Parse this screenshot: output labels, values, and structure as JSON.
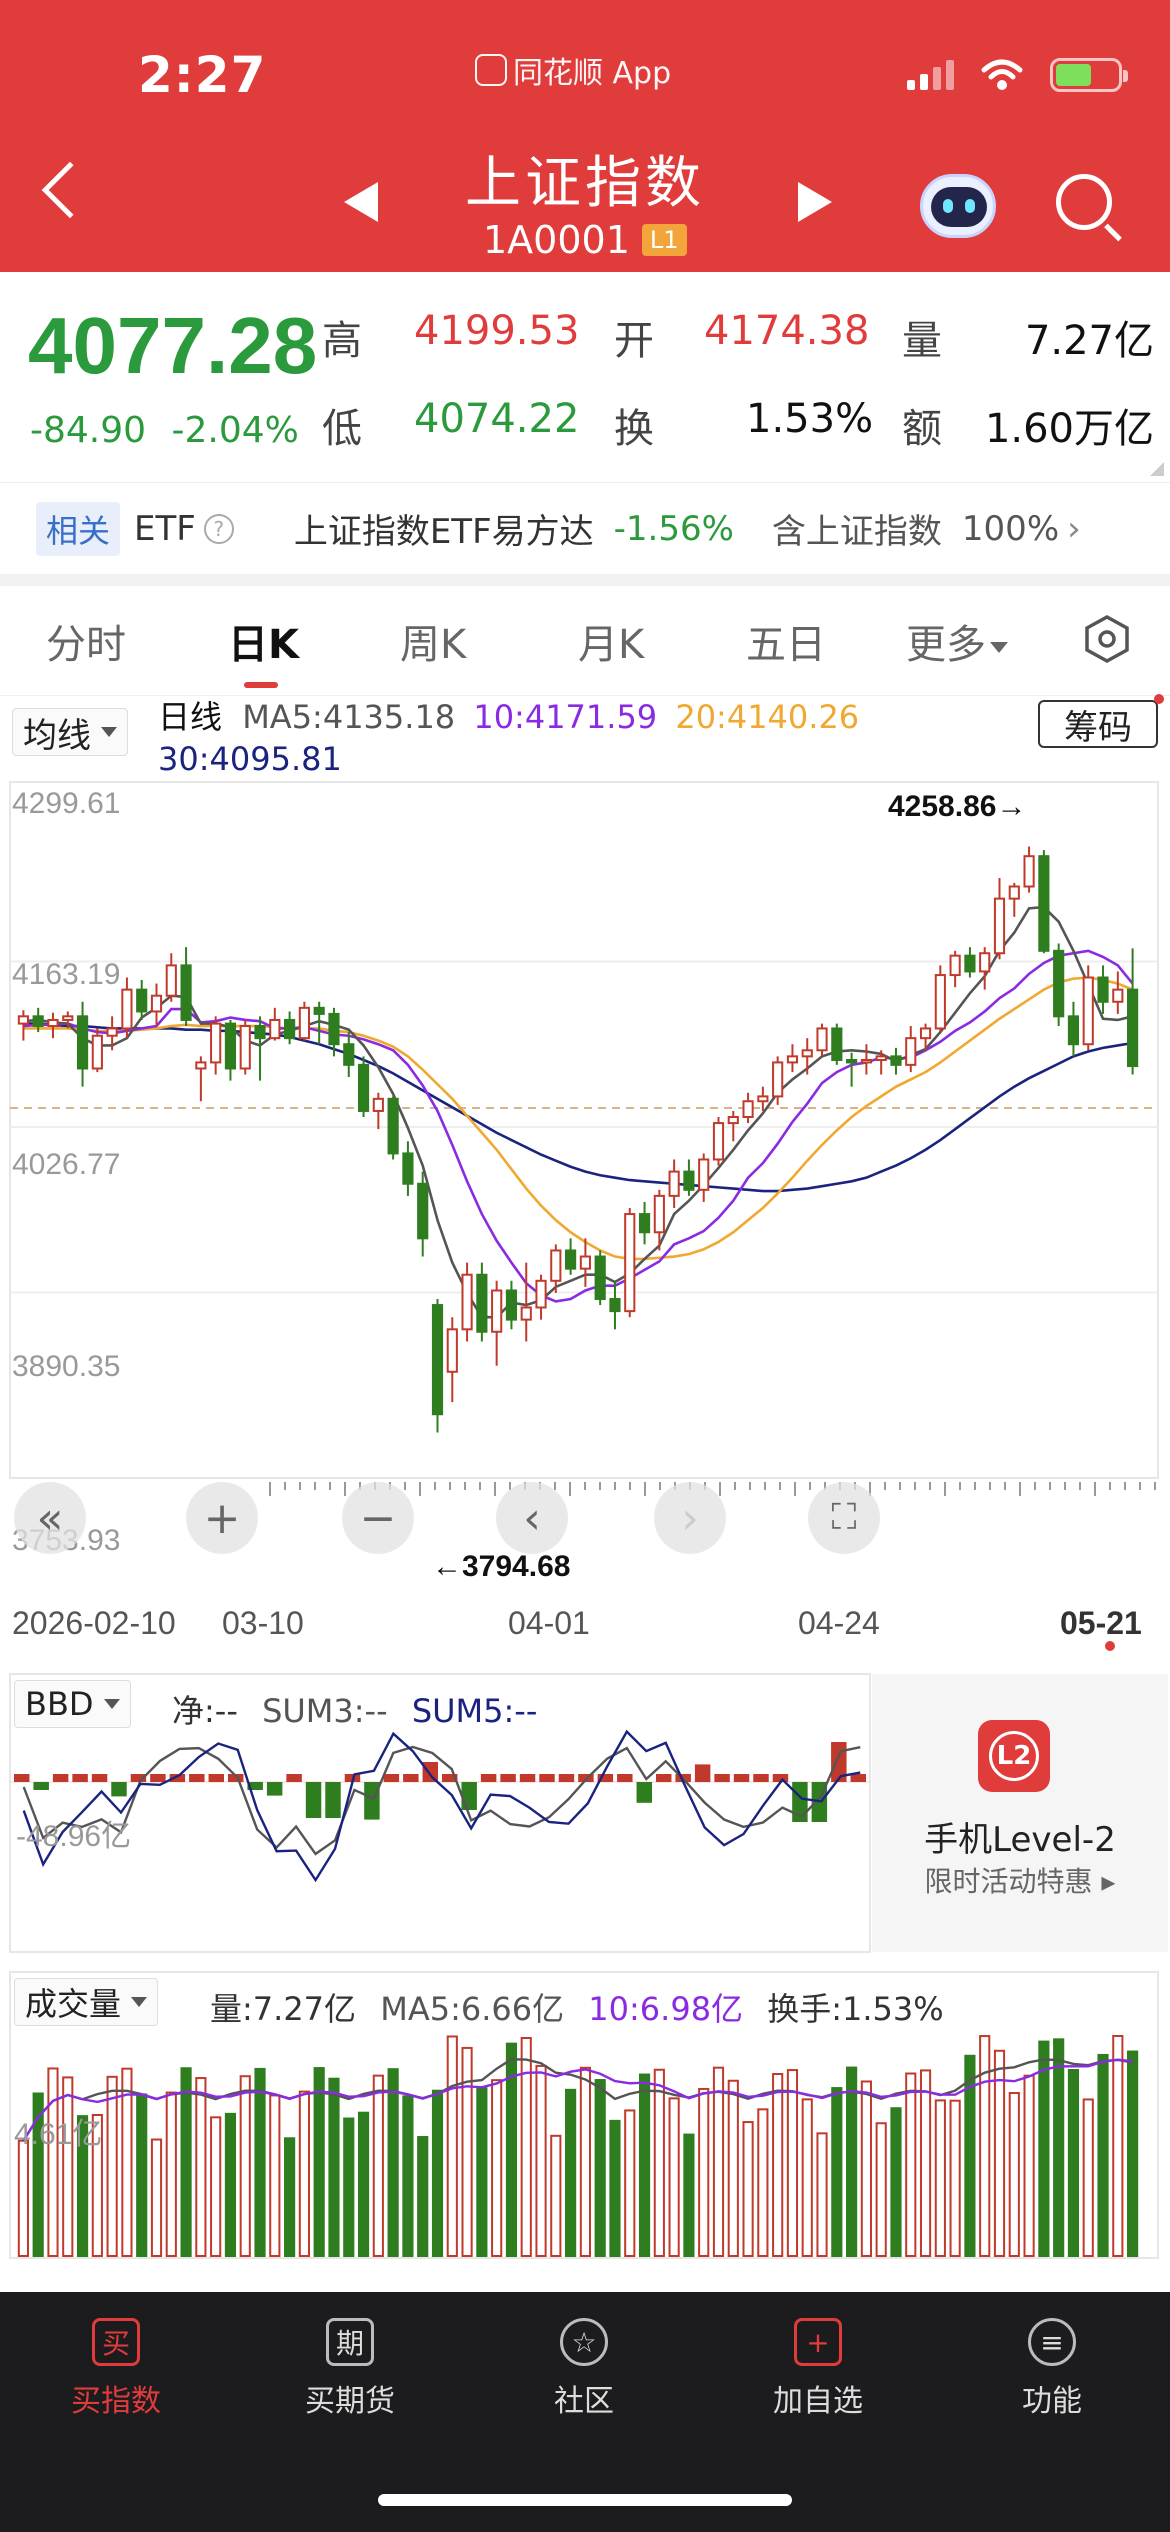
{
  "status": {
    "time": "2:27",
    "app_name": "同花顺 App"
  },
  "header": {
    "title": "上证指数",
    "code": "1A0001",
    "level_badge": "L1"
  },
  "quote": {
    "price": "4077.28",
    "change": "-84.90",
    "change_pct": "-2.04%",
    "high_label": "高",
    "high": "4199.53",
    "open_label": "开",
    "open": "4174.38",
    "volume_label": "量",
    "volume": "7.27亿",
    "low_label": "低",
    "low": "4074.22",
    "turnover_label": "换",
    "turnover": "1.53%",
    "amount_label": "额",
    "amount": "1.60万亿"
  },
  "related": {
    "tag": "相关",
    "etf": "ETF",
    "fund_name": "上证指数ETF易方达",
    "fund_change": "-1.56%",
    "contains": "含上证指数",
    "contains_pct": "100%"
  },
  "tabs": [
    {
      "label": "分时"
    },
    {
      "label": "日K"
    },
    {
      "label": "周K"
    },
    {
      "label": "月K"
    },
    {
      "label": "五日"
    },
    {
      "label": "更多"
    }
  ],
  "kline": {
    "ma_button": "均线",
    "period_label": "日线",
    "ma5": "MA5:4135.18",
    "ma10": "10:4171.59",
    "ma20": "20:4140.26",
    "ma30": "30:4095.81",
    "chip_button": "筹码",
    "y_ticks": [
      "4299.61",
      "4163.19",
      "4026.77",
      "3890.35",
      "3753.93"
    ],
    "high_marker": "4258.86→",
    "low_marker": "←3794.68",
    "x_ticks": [
      "2026-02-10",
      "03-10",
      "04-01",
      "04-24",
      "05-21"
    ]
  },
  "colors": {
    "up": "#c0392b",
    "down": "#2e7d1f",
    "ma5": "#555555",
    "ma10": "#8a2be2",
    "ma20": "#f0a830",
    "ma30": "#1a237e"
  },
  "bbd": {
    "button": "BBD",
    "net": "净:--",
    "sum3": "SUM3:--",
    "sum5": "SUM5:--",
    "axis_label": "-48.96亿"
  },
  "level2": {
    "title": "手机Level-2",
    "subtitle": "限时活动特惠 ▸",
    "logo": "L2"
  },
  "volume": {
    "button": "成交量",
    "vol": "量:7.27亿",
    "ma5": "MA5:6.66亿",
    "ma10": "10:6.98亿",
    "turnover": "换手:1.53%",
    "axis_label": "4.61亿"
  },
  "chart_data": {
    "type": "candlestick",
    "ylim": [
      3753.93,
      4299.61
    ],
    "candles": [
      [
        4112,
        4123,
        4098,
        4118
      ],
      [
        4118,
        4125,
        4105,
        4110
      ],
      [
        4110,
        4121,
        4100,
        4115
      ],
      [
        4115,
        4122,
        4108,
        4118
      ],
      [
        4118,
        4130,
        4060,
        4075
      ],
      [
        4075,
        4108,
        4072,
        4102
      ],
      [
        4102,
        4118,
        4090,
        4108
      ],
      [
        4108,
        4150,
        4100,
        4140
      ],
      [
        4140,
        4148,
        4115,
        4122
      ],
      [
        4122,
        4145,
        4110,
        4135
      ],
      [
        4135,
        4170,
        4130,
        4160
      ],
      [
        4160,
        4175,
        4110,
        4115
      ],
      [
        4075,
        4085,
        4048,
        4080
      ],
      [
        4080,
        4118,
        4070,
        4112
      ],
      [
        4112,
        4115,
        4065,
        4075
      ],
      [
        4075,
        4115,
        4070,
        4110
      ],
      [
        4110,
        4118,
        4065,
        4100
      ],
      [
        4100,
        4125,
        4098,
        4115
      ],
      [
        4115,
        4122,
        4095,
        4100
      ],
      [
        4100,
        4130,
        4098,
        4125
      ],
      [
        4125,
        4130,
        4095,
        4120
      ],
      [
        4120,
        4125,
        4085,
        4095
      ],
      [
        4095,
        4105,
        4068,
        4078
      ],
      [
        4078,
        4085,
        4035,
        4040
      ],
      [
        4040,
        4055,
        4025,
        4050
      ],
      [
        4050,
        4052,
        4000,
        4005
      ],
      [
        4005,
        4015,
        3970,
        3980
      ],
      [
        3980,
        3990,
        3920,
        3935
      ],
      [
        3880,
        3885,
        3775,
        3790
      ],
      [
        3825,
        3870,
        3800,
        3860
      ],
      [
        3860,
        3915,
        3850,
        3905
      ],
      [
        3905,
        3915,
        3850,
        3858
      ],
      [
        3858,
        3900,
        3830,
        3892
      ],
      [
        3892,
        3900,
        3860,
        3868
      ],
      [
        3868,
        3915,
        3850,
        3878
      ],
      [
        3878,
        3905,
        3868,
        3900
      ],
      [
        3900,
        3930,
        3890,
        3925
      ],
      [
        3925,
        3935,
        3905,
        3910
      ],
      [
        3910,
        3935,
        3895,
        3920
      ],
      [
        3920,
        3925,
        3880,
        3885
      ],
      [
        3885,
        3900,
        3860,
        3875
      ],
      [
        3875,
        3960,
        3870,
        3955
      ],
      [
        3955,
        3965,
        3930,
        3940
      ],
      [
        3940,
        3975,
        3925,
        3970
      ],
      [
        3970,
        4000,
        3960,
        3990
      ],
      [
        3990,
        4000,
        3970,
        3975
      ],
      [
        3975,
        4005,
        3965,
        4000
      ],
      [
        4000,
        4035,
        3995,
        4030
      ],
      [
        4030,
        4040,
        4015,
        4035
      ],
      [
        4035,
        4055,
        4030,
        4048
      ],
      [
        4048,
        4060,
        4040,
        4052
      ],
      [
        4052,
        4085,
        4045,
        4080
      ],
      [
        4080,
        4095,
        4072,
        4085
      ],
      [
        4085,
        4100,
        4070,
        4090
      ],
      [
        4090,
        4112,
        4085,
        4108
      ],
      [
        4108,
        4112,
        4078,
        4082
      ],
      [
        4082,
        4088,
        4060,
        4080
      ],
      [
        4080,
        4095,
        4070,
        4082
      ],
      [
        4082,
        4090,
        4070,
        4085
      ],
      [
        4085,
        4092,
        4070,
        4078
      ],
      [
        4078,
        4110,
        4072,
        4100
      ],
      [
        4100,
        4112,
        4090,
        4108
      ],
      [
        4108,
        4160,
        4105,
        4152
      ],
      [
        4152,
        4172,
        4142,
        4168
      ],
      [
        4168,
        4175,
        4150,
        4155
      ],
      [
        4155,
        4175,
        4140,
        4170
      ],
      [
        4170,
        4232,
        4165,
        4215
      ],
      [
        4215,
        4228,
        4200,
        4225
      ],
      [
        4225,
        4258,
        4220,
        4250
      ],
      [
        4250,
        4255,
        4170,
        4172
      ],
      [
        4172,
        4178,
        4110,
        4118
      ],
      [
        4118,
        4130,
        4085,
        4095
      ],
      [
        4095,
        4160,
        4090,
        4150
      ],
      [
        4150,
        4160,
        4120,
        4130
      ],
      [
        4130,
        4155,
        4120,
        4140
      ],
      [
        4140,
        4174,
        4070,
        4077
      ]
    ],
    "ma5": [
      4114,
      4115,
      4113,
      4112,
      4100,
      4094,
      4094,
      4100,
      4117,
      4125,
      4135,
      4134,
      4112,
      4112,
      4109,
      4098,
      4094,
      4103,
      4106,
      4110,
      4114,
      4111,
      4107,
      4094,
      4076,
      4054,
      4026,
      3995,
      3950,
      3915,
      3890,
      3870,
      3870,
      3882,
      3880,
      3884,
      3895,
      3900,
      3905,
      3905,
      3899,
      3906,
      3918,
      3929,
      3955,
      3966,
      3979,
      3993,
      4008,
      4024,
      4038,
      4055,
      4066,
      4075,
      4085,
      4089,
      4090,
      4089,
      4087,
      4081,
      4086,
      4091,
      4105,
      4121,
      4137,
      4151,
      4172,
      4187,
      4207,
      4208,
      4196,
      4172,
      4144,
      4116,
      4115,
      4118
    ],
    "ma10": [
      4110,
      4111,
      4111,
      4112,
      4108,
      4105,
      4104,
      4106,
      4108,
      4110,
      4124,
      4124,
      4113,
      4114,
      4117,
      4115,
      4114,
      4108,
      4108,
      4109,
      4106,
      4103,
      4102,
      4099,
      4095,
      4090,
      4078,
      4061,
      4040,
      4012,
      3982,
      3955,
      3933,
      3915,
      3898,
      3888,
      3883,
      3885,
      3892,
      3896,
      3896,
      3902,
      3909,
      3916,
      3930,
      3935,
      3941,
      3952,
      3966,
      3985,
      3997,
      4013,
      4031,
      4046,
      4063,
      4072,
      4078,
      4080,
      4084,
      4083,
      4084,
      4090,
      4097,
      4106,
      4113,
      4122,
      4133,
      4141,
      4153,
      4162,
      4168,
      4170,
      4172,
      4167,
      4160,
      4145
    ],
    "ma20": [
      4108,
      4108,
      4108,
      4108,
      4107,
      4106,
      4106,
      4106,
      4107,
      4108,
      4110,
      4111,
      4110,
      4110,
      4110,
      4110,
      4110,
      4109,
      4108,
      4108,
      4108,
      4106,
      4105,
      4102,
      4098,
      4093,
      4085,
      4074,
      4062,
      4050,
      4036,
      4022,
      4008,
      3992,
      3976,
      3962,
      3950,
      3940,
      3932,
      3925,
      3920,
      3918,
      3918,
      3919,
      3920,
      3922,
      3926,
      3932,
      3940,
      3950,
      3960,
      3972,
      3985,
      3999,
      4012,
      4024,
      4035,
      4044,
      4052,
      4060,
      4066,
      4072,
      4080,
      4089,
      4098,
      4107,
      4116,
      4124,
      4132,
      4140,
      4146,
      4149,
      4150,
      4148,
      4145,
      4140
    ],
    "ma30": [
      4112,
      4112,
      4111,
      4110,
      4110,
      4109,
      4108,
      4108,
      4108,
      4108,
      4108,
      4107,
      4107,
      4106,
      4106,
      4105,
      4104,
      4103,
      4101,
      4098,
      4095,
      4091,
      4087,
      4082,
      4077,
      4071,
      4064,
      4057,
      4050,
      4043,
      4036,
      4029,
      4022,
      4016,
      4010,
      4004,
      3999,
      3994,
      3990,
      3987,
      3985,
      3983,
      3982,
      3981,
      3980,
      3979,
      3978,
      3977,
      3976,
      3975,
      3974,
      3974,
      3975,
      3976,
      3978,
      3980,
      3982,
      3985,
      3990,
      3995,
      4001,
      4008,
      4016,
      4025,
      4034,
      4043,
      4052,
      4060,
      4067,
      4073,
      4079,
      4085,
      4089,
      4092,
      4094,
      4096
    ]
  }
}
